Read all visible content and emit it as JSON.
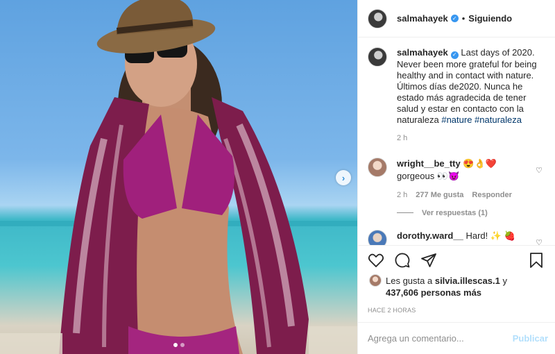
{
  "post": {
    "author": "salmahayek",
    "follow_label": "Siguiendo",
    "separator": "•",
    "verified_glyph": "✓"
  },
  "caption": {
    "author": "salmahayek",
    "text": "Last days of 2020. Never been more grateful for being healthy and in contact with nature. Últimos días de2020. Nunca he estado más agradecida de tener salud y estar en contacto con la naturaleza",
    "hashtags": "#nature #naturaleza",
    "time": "2 h"
  },
  "comments": [
    {
      "author": "wright__be_tty",
      "emoji": "😍👌❤️",
      "text": "gorgeous 👀😈",
      "time": "2 h",
      "likes": "277 Me gusta",
      "reply": "Responder"
    },
    {
      "author": "dorothy.ward__",
      "text": "Hard! ✨ 🍓"
    }
  ],
  "view_replies": "Ver respuestas (1)",
  "likes": {
    "prefix": "Les gusta a",
    "user": "silvia.illescas.1",
    "connector": "y",
    "count": "437,606 personas más"
  },
  "timeago": "HACE 2 HORAS",
  "add_comment": {
    "placeholder": "Agrega un comentario...",
    "publish": "Publicar"
  },
  "carousel": {
    "index": 1,
    "total": 2
  },
  "colors": {
    "accent": "#3897f0",
    "hashtag": "#00376b",
    "muted": "#8e8e8e",
    "publish_disabled": "#b2dffc"
  }
}
